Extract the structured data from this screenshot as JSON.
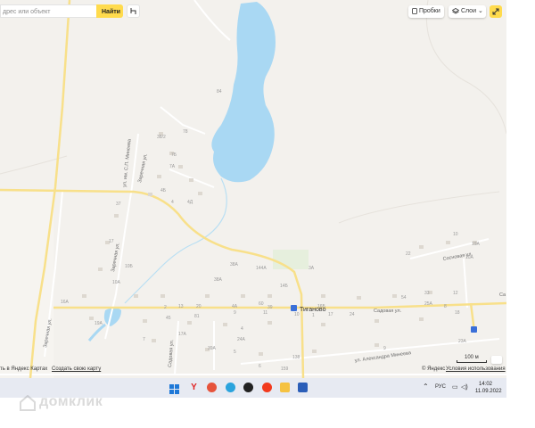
{
  "search": {
    "placeholder": "дрес или объект",
    "button_label": "Найти"
  },
  "controls": {
    "traffic_label": "Пробки",
    "layers_label": "Слои"
  },
  "map": {
    "water_color": "#a9d8f3",
    "road_color": "#f8e08a",
    "place_name": "Тиганово",
    "streets": {
      "sadovaya_main": "Садовая ул.",
      "sadovaya_side": "Садовая ул.",
      "zarechnaya_1": "Заречная ул.",
      "zarechnaya_2": "Заречная ул.",
      "zarechnaya_3": "Заречная ул.",
      "mineeva": "ул. им. С.П. Минеева",
      "sosnovaya": "Сосновая ул.",
      "aleksandra_mineeva": "ул. Александра Минеева",
      "edge_label": "Са"
    },
    "house_numbers": [
      "84",
      "38/2",
      "78",
      "7Б",
      "7А",
      "4Б",
      "4Д",
      "4",
      "37",
      "17",
      "16А",
      "10А",
      "19А",
      "10Б",
      "38А",
      "144А",
      "38А",
      "14Б",
      "3А",
      "24А",
      "39А",
      "17А",
      "4А",
      "9",
      "11",
      "39",
      "10",
      "1",
      "23А",
      "138",
      "159",
      "16Б",
      "12",
      "33",
      "54",
      "81",
      "60",
      "25А",
      "13",
      "20",
      "22",
      "10",
      "19А",
      "10А",
      "8",
      "18",
      "7",
      "4",
      "2",
      "5",
      "6",
      "9",
      "17",
      "24",
      "45"
    ]
  },
  "footer": {
    "open_in": "ть в Яндекс Картах",
    "create_map": "Создать свою карту",
    "copyright": "© Яндекс",
    "terms": "Условия использования",
    "scale": "100 м"
  },
  "taskbar": {
    "lang": "РУС",
    "time": "14:02",
    "date": "11.09.2022"
  },
  "watermark": "домклик"
}
